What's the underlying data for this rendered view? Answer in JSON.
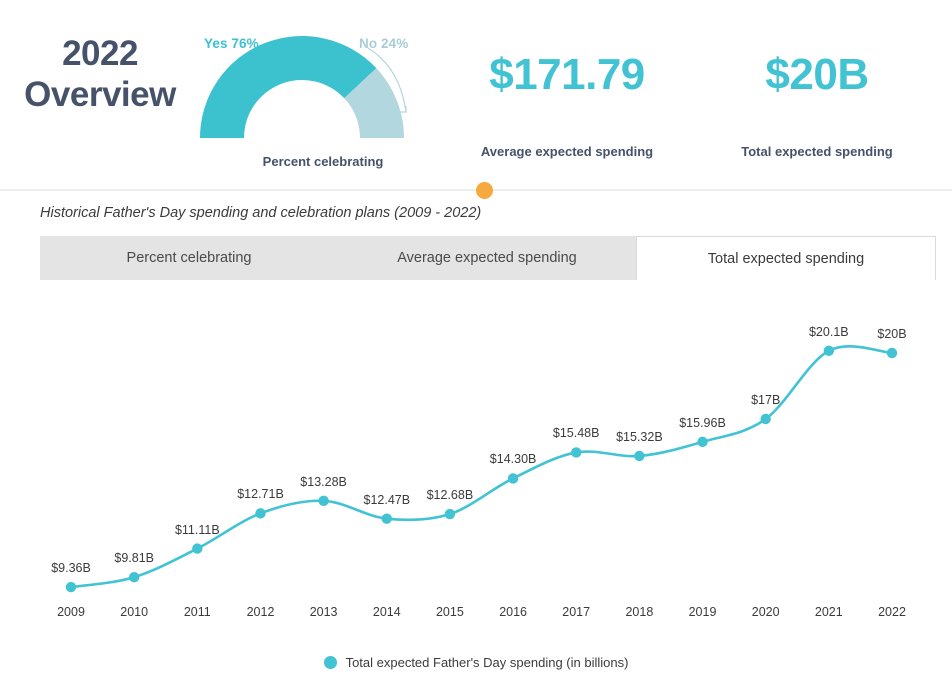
{
  "header": {
    "title": "2022\nOverview",
    "gauge": {
      "yes_label": "Yes 76%",
      "no_label": "No 24%",
      "caption": "Percent celebrating",
      "yes_pct": 76,
      "no_pct": 24,
      "yes_color": "#3cc1cf",
      "no_color": "#b3d7de"
    },
    "kpis": [
      {
        "value": "$171.79",
        "caption": "Average expected spending"
      },
      {
        "value": "$20B",
        "caption": "Total expected spending"
      }
    ],
    "accent_color": "#41c3d3",
    "title_color": "#46526a",
    "divider_dot_color": "#f5a93f"
  },
  "chart_subtitle": "Historical Father's Day spending and celebration plans (2009 - 2022)",
  "tabs": [
    {
      "label": "Percent celebrating",
      "active": false
    },
    {
      "label": "Average expected spending",
      "active": false
    },
    {
      "label": "Total expected spending",
      "active": true
    }
  ],
  "legend": {
    "label": "Total expected Father's Day spending (in billions)",
    "color": "#41c3d3"
  },
  "chart_data": {
    "type": "line",
    "title": "",
    "subtitle": "Historical Father's Day spending and celebration plans (2009 - 2022)",
    "xlabel": "",
    "ylabel": "",
    "grid": false,
    "legend_position": "bottom",
    "series_color": "#41c3d3",
    "categories": [
      "2009",
      "2010",
      "2011",
      "2012",
      "2013",
      "2014",
      "2015",
      "2016",
      "2017",
      "2018",
      "2019",
      "2020",
      "2021",
      "2022"
    ],
    "point_labels": [
      "$9.36B",
      "$9.81B",
      "$11.11B",
      "$12.71B",
      "$13.28B",
      "$12.47B",
      "$12.68B",
      "$14.30B",
      "$15.48B",
      "$15.32B",
      "$15.96B",
      "$17B",
      "$20.1B",
      "$20B"
    ],
    "series": [
      {
        "name": "Total expected Father's Day spending (in billions)",
        "values": [
          9.36,
          9.81,
          11.11,
          12.71,
          13.28,
          12.47,
          12.68,
          14.3,
          15.48,
          15.32,
          15.96,
          17.0,
          20.1,
          20.0
        ]
      }
    ],
    "ylim": [
      8.5,
      21.0
    ]
  }
}
